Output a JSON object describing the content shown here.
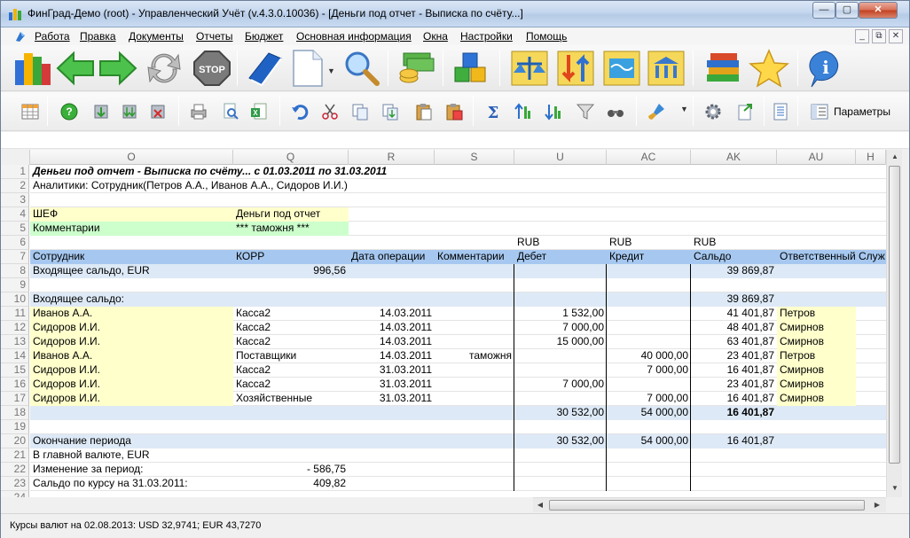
{
  "window": {
    "title": "ФинГрад-Демо (root)  - Управленческий Учёт (v.4.3.0.10036) - [Деньги под отчет - Выписка по счёту...]",
    "min": "—",
    "max": "▢",
    "close": "✕"
  },
  "menu": {
    "items": [
      "Работа",
      "Правка",
      "Документы",
      "Отчеты",
      "Бюджет",
      "Основная информация",
      "Окна",
      "Настройки",
      "Помощь"
    ],
    "mdi_min": "_",
    "mdi_restore": "⧉",
    "mdi_close": "✕"
  },
  "toolbar2": {
    "params_label": "Параметры"
  },
  "grid": {
    "columns": [
      "O",
      "Q",
      "R",
      "S",
      "U",
      "AC",
      "AK",
      "AU",
      "H"
    ],
    "row_numbers": [
      "1",
      "2",
      "3",
      "4",
      "5",
      "6",
      "7",
      "8",
      "9",
      "10",
      "11",
      "12",
      "13",
      "14",
      "15",
      "16",
      "17",
      "18",
      "19",
      "20",
      "21",
      "22",
      "23",
      "24"
    ],
    "title": "Деньги под отчет - Выписка по счёту... с 01.03.2011 по 31.03.2011",
    "analytics": "Аналитики: Сотрудник(Петров А.А., Иванов А.А., Сидоров И.И.)",
    "r4": {
      "o": "ШЕФ",
      "q": "Деньги под отчет"
    },
    "r5": {
      "o": "Комментарии",
      "q": "*** таможня ***"
    },
    "r6": {
      "u": "RUB",
      "ac": "RUB",
      "ak": "RUB"
    },
    "headers": {
      "employee": "Сотрудник",
      "korr": "КОРР",
      "date": "Дата операции",
      "comments": "Комментарии",
      "debit": "Дебет",
      "credit": "Кредит",
      "balance": "Сальдо",
      "responsible": "Ответственный",
      "service": "Служ"
    },
    "r8": {
      "o": "Входящее сальдо, EUR",
      "q": "996,56",
      "ak": "39 869,87"
    },
    "r10": {
      "o": "Входящее сальдо:",
      "ak": "39 869,87"
    },
    "rows": [
      {
        "emp": "Иванов А.А.",
        "korr": "Касса2",
        "date": "14.03.2011",
        "comment": "",
        "debit": "1 532,00",
        "credit": "",
        "balance": "41 401,87",
        "resp": "Петров"
      },
      {
        "emp": "Сидоров И.И.",
        "korr": "Касса2",
        "date": "14.03.2011",
        "comment": "",
        "debit": "7 000,00",
        "credit": "",
        "balance": "48 401,87",
        "resp": "Смирнов"
      },
      {
        "emp": "Сидоров И.И.",
        "korr": "Касса2",
        "date": "14.03.2011",
        "comment": "",
        "debit": "15 000,00",
        "credit": "",
        "balance": "63 401,87",
        "resp": "Смирнов"
      },
      {
        "emp": "Иванов А.А.",
        "korr": "Поставщики",
        "date": "14.03.2011",
        "comment": "таможня",
        "debit": "",
        "credit": "40 000,00",
        "balance": "23 401,87",
        "resp": "Петров"
      },
      {
        "emp": "Сидоров И.И.",
        "korr": "Касса2",
        "date": "31.03.2011",
        "comment": "",
        "debit": "",
        "credit": "7 000,00",
        "balance": "16 401,87",
        "resp": "Смирнов"
      },
      {
        "emp": "Сидоров И.И.",
        "korr": "Касса2",
        "date": "31.03.2011",
        "comment": "",
        "debit": "7 000,00",
        "credit": "",
        "balance": "23 401,87",
        "resp": "Смирнов"
      },
      {
        "emp": "Сидоров И.И.",
        "korr": "Хозяйственные",
        "date": "31.03.2011",
        "comment": "",
        "debit": "",
        "credit": "7 000,00",
        "balance": "16 401,87",
        "resp": "Смирнов"
      }
    ],
    "r18": {
      "debit": "30 532,00",
      "credit": "54 000,00",
      "balance": "16 401,87"
    },
    "r20": {
      "o": "Окончание периода",
      "debit": "30 532,00",
      "credit": "54 000,00",
      "balance": "16 401,87"
    },
    "r21": {
      "o": "В главной валюте, EUR"
    },
    "r22": {
      "o": "Изменение за период:",
      "q": "-   586,75"
    },
    "r23": {
      "o": "Сальдо по курсу на 31.03.2011:",
      "q": "409,82"
    }
  },
  "status": "Курсы валют на 02.08.2013:  USD 32,9741;  EUR 43,7270",
  "colors": {
    "yellow": "#ffffcc",
    "green": "#ccffcc",
    "blue_row": "#dde9f6",
    "header_row": "#a6c8f0"
  }
}
